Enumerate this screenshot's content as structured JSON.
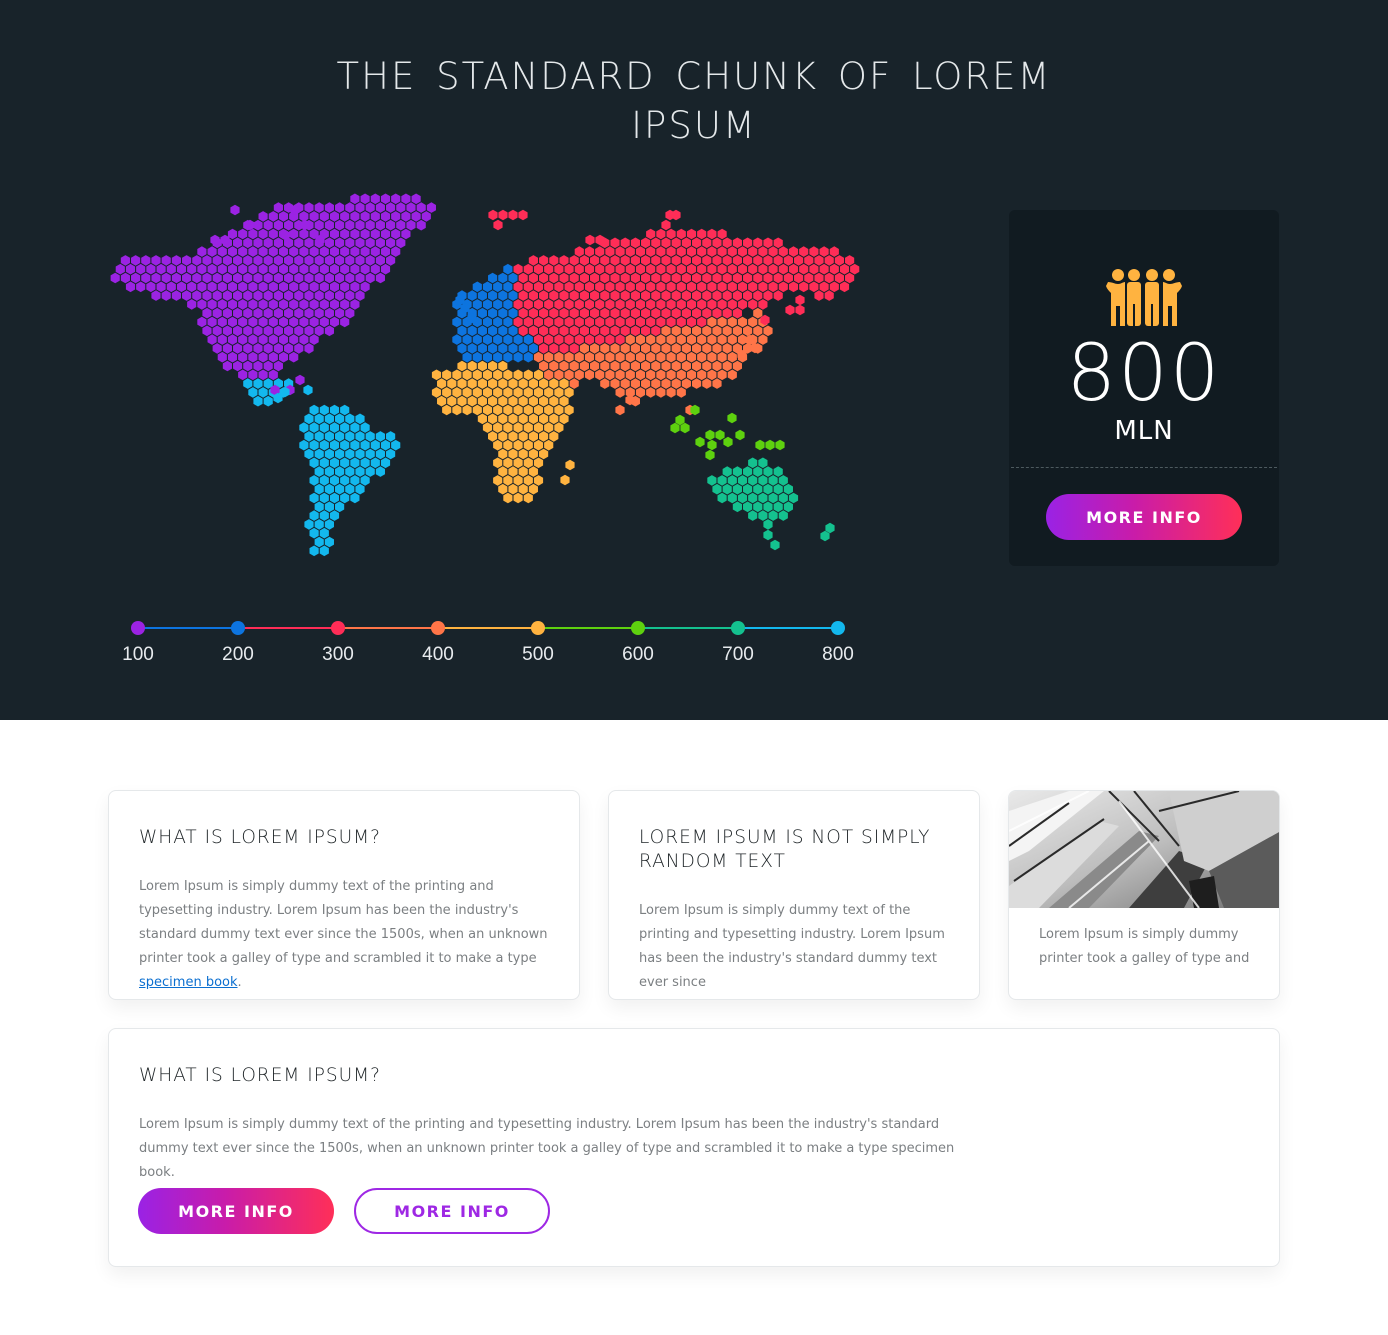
{
  "hero": {
    "title": "THE STANDARD CHUNK OF LOREM IPSUM"
  },
  "map": {
    "regions": [
      {
        "name": "north-america",
        "color": "#9b23e3"
      },
      {
        "name": "europe",
        "color": "#0d74df"
      },
      {
        "name": "russia",
        "color": "#ff2d57"
      },
      {
        "name": "asia",
        "color": "#ff7548"
      },
      {
        "name": "africa",
        "color": "#ffb340"
      },
      {
        "name": "indonesia",
        "color": "#5ed10f"
      },
      {
        "name": "australia",
        "color": "#14c18f"
      },
      {
        "name": "south-america",
        "color": "#13b8ee"
      }
    ]
  },
  "legend": {
    "labels": [
      "100",
      "200",
      "300",
      "400",
      "500",
      "600",
      "700",
      "800"
    ],
    "colors": [
      "#9b23e3",
      "#0d74df",
      "#ff2d57",
      "#ff7548",
      "#ffb340",
      "#5ed10f",
      "#14c18f",
      "#13b8ee"
    ]
  },
  "stat": {
    "icon": "people-group-icon",
    "icon_color": "#ffb340",
    "value": "800",
    "unit": "MLN",
    "button_label": "MORE INFO"
  },
  "cards": [
    {
      "title": "WHAT IS LOREM IPSUM?",
      "text": "Lorem Ipsum is simply dummy text of the printing and typesetting industry. Lorem Ipsum has been the industry's standard dummy text ever since the 1500s, when an unknown printer took a galley of type and scrambled it to make a type",
      "link": "specimen book",
      "after_link": "."
    },
    {
      "title": "LOREM IPSUM IS NOT SIMPLY RANDOM TEXT",
      "text": "Lorem Ipsum is simply dummy text of the printing and typesetting industry. Lorem Ipsum has been the industry's standard dummy text ever since"
    },
    {
      "image": "architecture-photo",
      "text": "Lorem Ipsum is simply dummy printer took a galley of type and"
    }
  ],
  "wide_card": {
    "title": "WHAT IS LOREM IPSUM?",
    "text": "Lorem Ipsum is simply dummy text of the printing and typesetting industry. Lorem Ipsum has been the industry's standard dummy text ever since the 1500s, when an unknown printer took a galley of type and scrambled it to make a type specimen book.",
    "primary_button": "MORE INFO",
    "secondary_button": "MORE INFO"
  }
}
